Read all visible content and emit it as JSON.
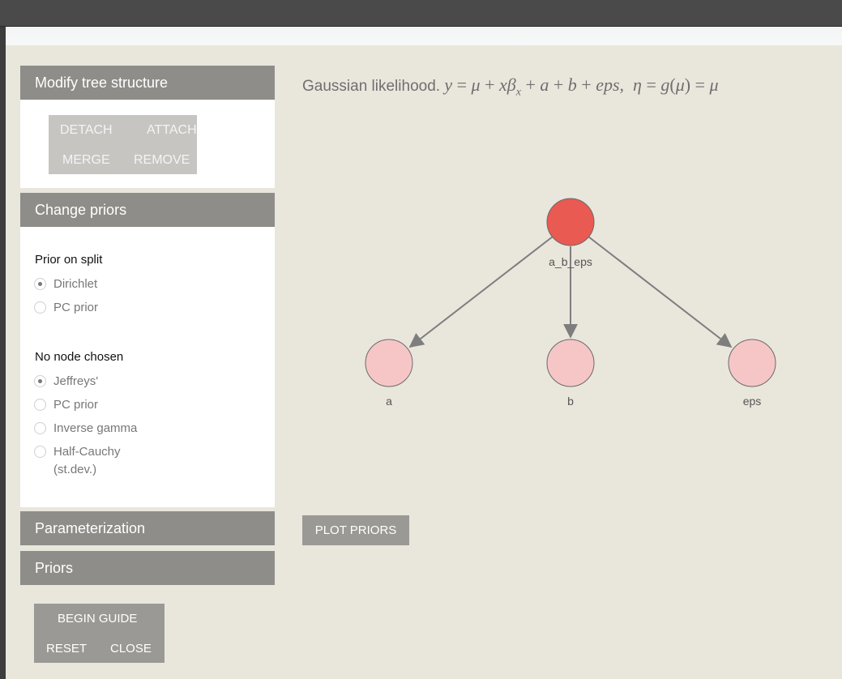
{
  "tree_panel": {
    "title": "Modify tree structure",
    "buttons": {
      "detach": "DETACH",
      "attach": "ATTACH",
      "merge": "MERGE",
      "remove": "REMOVE"
    }
  },
  "priors_panel": {
    "title": "Change priors",
    "split_label": "Prior on split",
    "split_options": [
      "Dirichlet",
      "PC prior"
    ],
    "split_selected": "Dirichlet",
    "node_label": "No node chosen",
    "node_options": [
      "Jeffreys'",
      "PC prior",
      "Inverse gamma",
      "Half-Cauchy\n(st.dev.)"
    ],
    "node_selected": "Jeffreys'"
  },
  "parameterization_panel": {
    "title": "Parameterization"
  },
  "priors_summary_panel": {
    "title": "Priors"
  },
  "guide": {
    "begin": "BEGIN GUIDE",
    "reset": "RESET",
    "close": "CLOSE"
  },
  "main": {
    "likelihood_title": "Gaussian likelihood.",
    "plot_priors_label": "PLOT PRIORS"
  },
  "tree": {
    "root": {
      "label": "a_b_eps",
      "color": "#e85a52"
    },
    "children": [
      {
        "label": "a",
        "color": "#f6c6c6"
      },
      {
        "label": "b",
        "color": "#f6c6c6"
      },
      {
        "label": "eps",
        "color": "#f6c6c6"
      }
    ]
  }
}
